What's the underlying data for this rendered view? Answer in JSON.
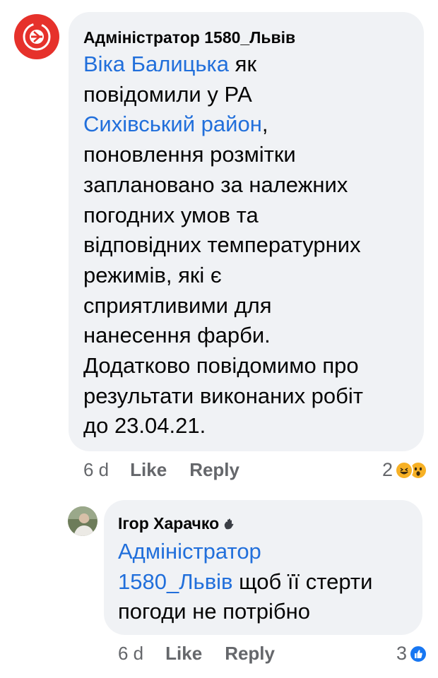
{
  "comments": [
    {
      "author": "Адміністратор 1580_Львів",
      "lines": [
        [
          "Віка Балицька",
          " як"
        ],
        [
          "повідомили у РА"
        ],
        [
          "Сихівський район",
          ","
        ],
        [
          "поновлення розмітки"
        ],
        [
          "заплановано за належних"
        ],
        [
          "погодних умов та"
        ],
        [
          "відповідних температурних"
        ],
        [
          "режимів, які є"
        ],
        [
          "сприятливими для"
        ],
        [
          "нанесення фарби."
        ],
        [
          "Додатково повідомимо про"
        ],
        [
          "результати виконаних робіт"
        ],
        [
          "до 23.04.21."
        ]
      ],
      "mentions": {
        "m1": "Віка Балицька",
        "m2": "Сихівський район"
      },
      "time": "6 d",
      "like_label": "Like",
      "reply_label": "Reply",
      "reaction_count": "2",
      "reactions": [
        "haha-icon",
        "wow-icon"
      ]
    },
    {
      "author": "Ігор Харачко",
      "author_badge": "waving-hand-icon",
      "mention_line1": "Адміністратор",
      "mention_line2": "1580_Львів",
      "text_after_mention": " щоб її стерти",
      "text_line3": "погоди не потрібно",
      "time": "6 d",
      "like_label": "Like",
      "reply_label": "Reply",
      "reaction_count": "3",
      "reactions": [
        "like-icon"
      ]
    }
  ],
  "colors": {
    "mention": "#216fdb",
    "bubble": "#f0f2f5",
    "meta": "#65676b",
    "avatar_brand": "#e6312b"
  }
}
